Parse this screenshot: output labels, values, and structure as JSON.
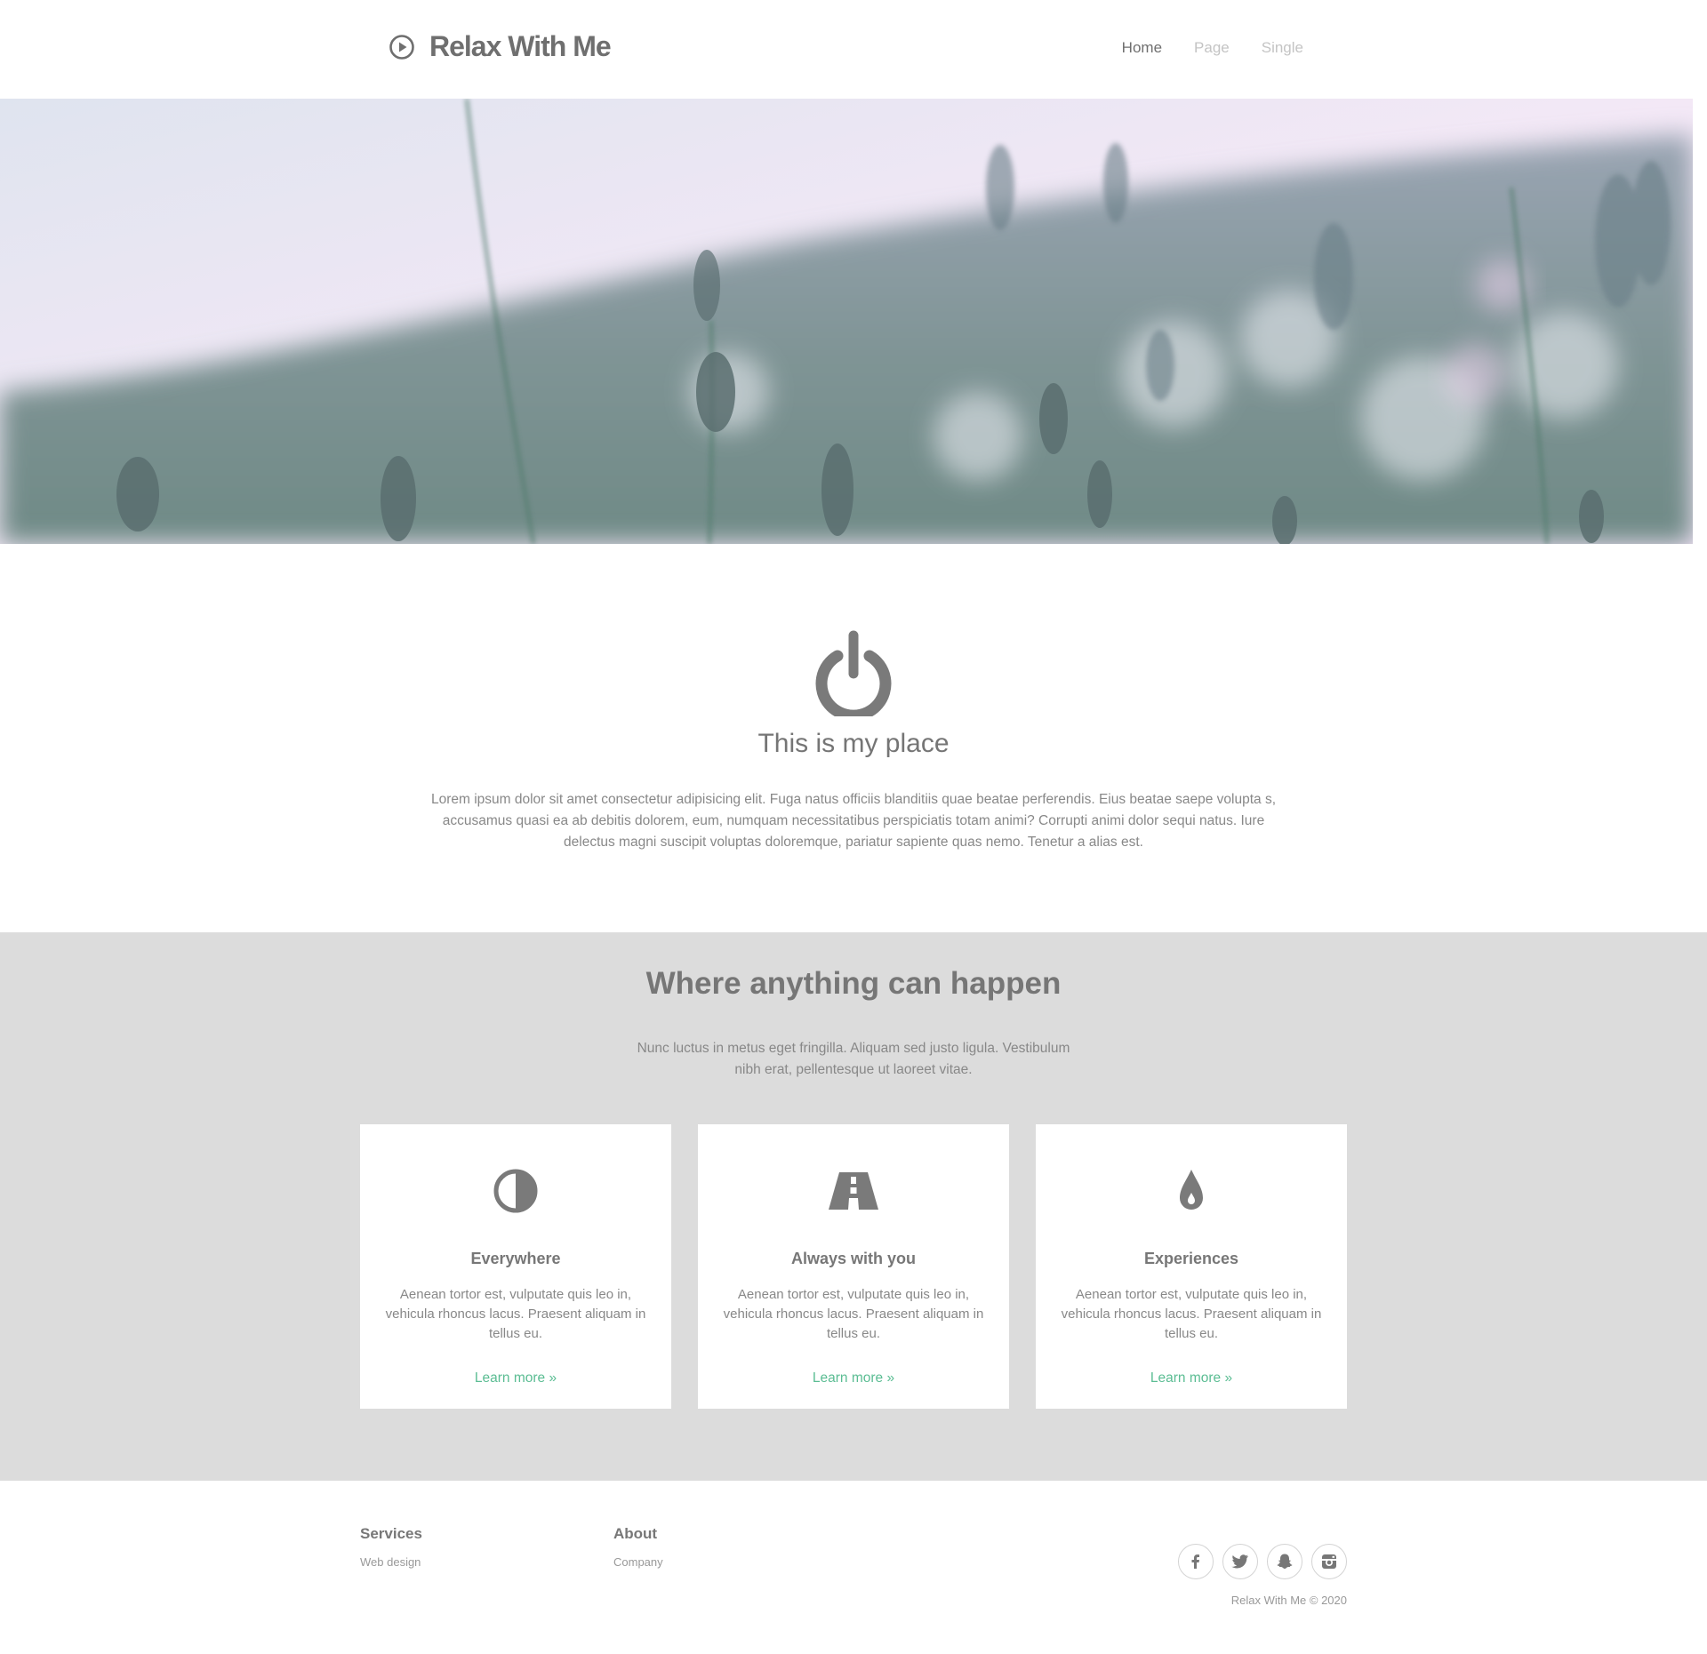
{
  "header": {
    "brand": "Relax With Me",
    "nav": [
      "Home",
      "Page",
      "Single"
    ]
  },
  "hero": {
    "image": "blurred grass field photo"
  },
  "intro": {
    "title": "This is my place",
    "text": "Lorem ipsum dolor sit amet consectetur adipisicing elit. Fuga natus officiis blanditiis quae beatae perferendis. Eius beatae saepe volupta s, accusamus quasi ea ab debitis dolorem, eum, numquam necessitatibus perspiciatis totam animi? Corrupti animi dolor sequi natus. Iure delectus magni suscipit voluptas doloremque, pariatur sapiente quas nemo. Tenetur a alias est."
  },
  "features": {
    "title": "Where anything can happen",
    "lead": "Nunc luctus in metus eget fringilla. Aliquam sed justo ligula. Vestibulum nibh erat, pellentesque ut laoreet vitae.",
    "cards": [
      {
        "icon": "contrast-icon",
        "title": "Everywhere",
        "text": "Aenean tortor est, vulputate quis leo in, vehicula rhoncus lacus. Praesent aliquam in tellus eu.",
        "link": "Learn more »"
      },
      {
        "icon": "road-icon",
        "title": "Always with you",
        "text": "Aenean tortor est, vulputate quis leo in, vehicula rhoncus lacus. Praesent aliquam in tellus eu.",
        "link": "Learn more »"
      },
      {
        "icon": "drop-icon",
        "title": "Experiences",
        "text": "Aenean tortor est, vulputate quis leo in, vehicula rhoncus lacus. Praesent aliquam in tellus eu.",
        "link": "Learn more »"
      }
    ]
  },
  "footer": {
    "columns": [
      {
        "title": "Services",
        "link": "Web design"
      },
      {
        "title": "About",
        "link": "Company"
      }
    ],
    "social": [
      "facebook-icon",
      "twitter-icon",
      "snapchat-icon",
      "instagram-icon"
    ],
    "copyright": "Relax With Me © 2020"
  },
  "colors": {
    "accent": "#5bbd93",
    "section_bg": "#dcdcdc",
    "text": "#7a7a7a"
  }
}
